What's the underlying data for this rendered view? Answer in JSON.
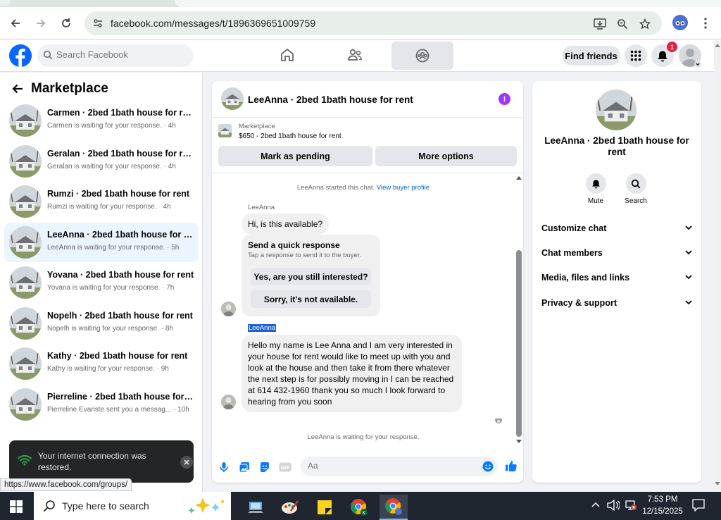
{
  "browser": {
    "url": "facebook.com/messages/t/1896369651009759",
    "status_url": "https://www.facebook.com/groups/"
  },
  "fb_header": {
    "search_placeholder": "Search Facebook",
    "find_friends_label": "Find friends",
    "notification_count": "1"
  },
  "sidebar": {
    "title": "Marketplace",
    "conversations": [
      {
        "name": "Carmen · 2bed 1bath house for rent",
        "preview": "Carmen is waiting for your response. · 4h"
      },
      {
        "name": "Geralan · 2bed 1bath house for rent",
        "preview": "Geralan is waiting for your response. · 4h"
      },
      {
        "name": "Rumzi · 2bed 1bath house for rent",
        "preview": "Rumzi is waiting for your response. · 4h"
      },
      {
        "name": "LeeAnna · 2bed 1bath house for rent",
        "preview": "LeeAnna is waiting for your response. · 5h"
      },
      {
        "name": "Yovana · 2bed 1bath house for rent",
        "preview": "Yovana is waiting for your response. · 7h"
      },
      {
        "name": "Nopelh · 2bed 1bath house for rent",
        "preview": "Nopelh is waiting for your response. · 8h"
      },
      {
        "name": "Kathy · 2bed 1bath house for rent",
        "preview": "Kathy is waiting for your response. · 9h"
      },
      {
        "name": "Pierreline · 2bed 1bath house for r...",
        "preview": "Pierreline Evariste sent you a messag... · 10h"
      }
    ]
  },
  "toast": {
    "message": "Your internet connection was restored."
  },
  "chat": {
    "title": "LeeAnna · 2bed 1bath house for rent",
    "listing_category": "Marketplace",
    "listing_price": "$650 - 2bed 1bath house for rent",
    "mark_pending_label": "Mark as pending",
    "more_options_label": "More options",
    "started_text": "LeeAnna started this chat.",
    "view_profile_link": "View buyer profile",
    "sender_name_1": "LeeAnna",
    "message_1": "Hi, is this available?",
    "quick_title": "Send a quick response",
    "quick_subtitle": "Tap a response to send it to the buyer.",
    "quick_option_1": "Yes, are you still interested?",
    "quick_option_2": "Sorry, it's not available.",
    "sender_name_2": "LeeAnna",
    "message_2": "Hello my name is Lee Anna and I am very interested in your house for rent would like to meet up with you and look at the house and then take it from there whatever the next step is for possibly moving in I can be reached at 614 432-1960 thank you so much I look forward to hearing from you soon",
    "waiting_text": "LeeAnna is waiting for your response.",
    "composer_placeholder": "Aa"
  },
  "right_panel": {
    "name": "LeeAnna · 2bed 1bath house for rent",
    "mute_label": "Mute",
    "search_label": "Search",
    "sections": [
      "Customize chat",
      "Chat members",
      "Media, files and links",
      "Privacy & support"
    ]
  },
  "taskbar": {
    "search_placeholder": "Type here to search",
    "time": "7:53 PM",
    "date": "12/15/2025"
  },
  "colors": {
    "fb_blue": "#0866ff",
    "active_conv_bg": "#ebf5ff",
    "messenger_icons": "#0a7cff",
    "info_purple": "#a334fa",
    "notif_red": "#e41e3f"
  }
}
